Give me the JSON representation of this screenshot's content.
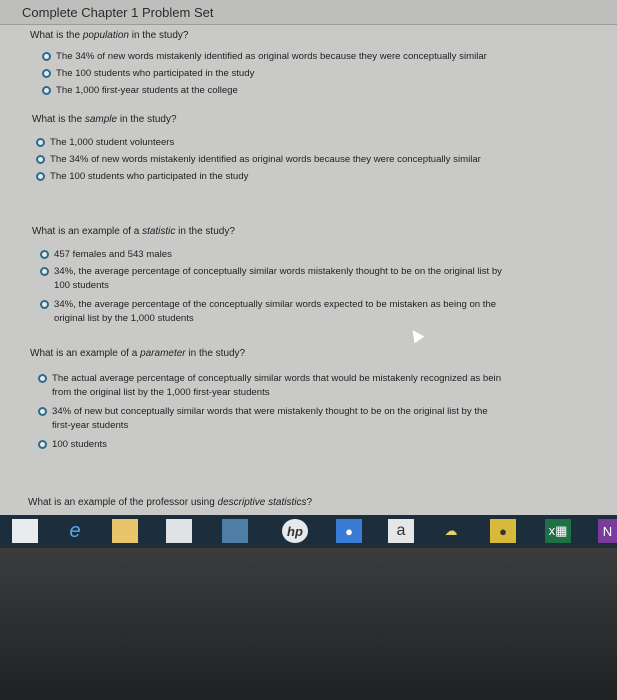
{
  "header": {
    "title": "Complete Chapter 1 Problem Set"
  },
  "questions": [
    {
      "prefix": "What is the ",
      "emph": "population",
      "suffix": " in the study?",
      "options": [
        {
          "lines": [
            "The 34% of new words mistakenly identified as original words because they were conceptually similar"
          ],
          "selected": false
        },
        {
          "lines": [
            "The 100 students who participated in the study"
          ],
          "selected": false
        },
        {
          "lines": [
            "The 1,000 first-year students at the college"
          ],
          "selected": false
        }
      ]
    },
    {
      "prefix": "What is the ",
      "emph": "sample",
      "suffix": " in the study?",
      "options": [
        {
          "lines": [
            "The 1,000 student volunteers"
          ],
          "selected": false
        },
        {
          "lines": [
            "The 34% of new words mistakenly identified as original words because they were conceptually similar"
          ],
          "selected": false
        },
        {
          "lines": [
            "The 100 students who participated in the study"
          ],
          "selected": false
        }
      ]
    },
    {
      "prefix": "What is an example of a ",
      "emph": "statistic",
      "suffix": " in the study?",
      "options": [
        {
          "lines": [
            "457 females and 543 males"
          ],
          "selected": false
        },
        {
          "lines": [
            "34%, the average percentage of conceptually similar words mistakenly thought to be on the original list by",
            "100 students"
          ],
          "selected": false
        },
        {
          "lines": [
            "34%, the average percentage of the conceptually similar words expected to be mistaken as being on the",
            "original list by the 1,000 students"
          ],
          "selected": false
        }
      ]
    },
    {
      "prefix": "What is an example of a ",
      "emph": "parameter",
      "suffix": " in the study?",
      "options": [
        {
          "lines": [
            "The actual average percentage of conceptually similar words that would be mistakenly recognized as bein",
            "from the original list by the 1,000 first-year students"
          ],
          "selected": false
        },
        {
          "lines": [
            "34% of new but conceptually similar words that were mistakenly thought to be on the original list by the",
            "first-year students"
          ],
          "selected": false
        },
        {
          "lines": [
            "100 students"
          ],
          "selected": false
        }
      ]
    },
    {
      "prefix": "What is an example of the professor using ",
      "emph": "descriptive statistics",
      "suffix": "?",
      "options": []
    }
  ],
  "taskbar": {
    "items": [
      {
        "name": "windows-start-icon",
        "glyph": "",
        "bg": "#e9ecee"
      },
      {
        "name": "edge-browser-icon",
        "glyph": "e",
        "bg": "transparent"
      },
      {
        "name": "file-explorer-icon",
        "glyph": "",
        "bg": "#e8c56a"
      },
      {
        "name": "store-icon",
        "glyph": "",
        "bg": "#dfe3e6"
      },
      {
        "name": "photos-icon",
        "glyph": "",
        "bg": "#4e7ea6"
      },
      {
        "name": "hp-icon",
        "glyph": "hp",
        "bg": "#e6e9ec"
      },
      {
        "name": "support-icon",
        "glyph": "●",
        "bg": "#3a7bd5"
      },
      {
        "name": "amazon-icon",
        "glyph": "a",
        "bg": "#e4e6e8"
      },
      {
        "name": "cloud-icon",
        "glyph": "☁",
        "bg": "transparent"
      },
      {
        "name": "chrome-icon",
        "glyph": "●",
        "bg": "#d9b93a"
      },
      {
        "name": "excel-icon",
        "glyph": "x▦",
        "bg": "#1e7145"
      },
      {
        "name": "onenote-icon",
        "glyph": "N",
        "bg": "#7a3b9a"
      }
    ]
  }
}
